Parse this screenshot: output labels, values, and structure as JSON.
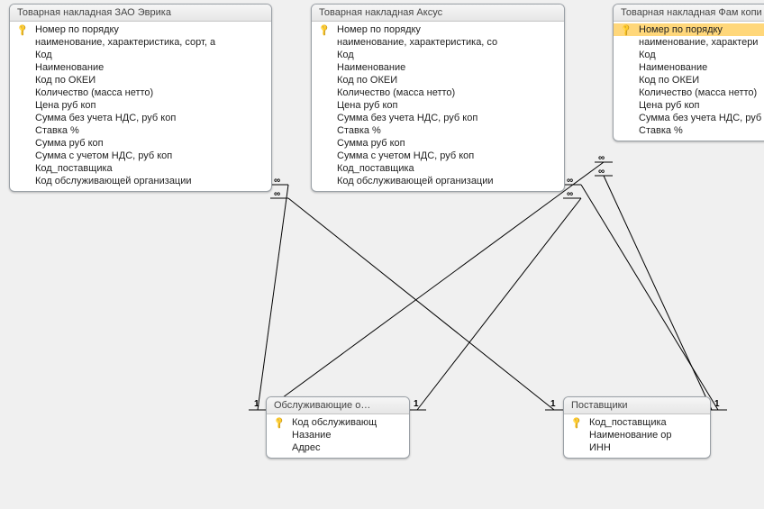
{
  "tables": {
    "evrika": {
      "title": "Товарная накладная ЗАО Эврика",
      "fields": [
        {
          "name": "Номер по порядку",
          "pk": true
        },
        {
          "name": "наименование, характеристика, сорт, а",
          "pk": false
        },
        {
          "name": "Код",
          "pk": false
        },
        {
          "name": "Наименование",
          "pk": false
        },
        {
          "name": "Код по ОКЕИ",
          "pk": false
        },
        {
          "name": "Количество (масса нетто)",
          "pk": false
        },
        {
          "name": "Цена руб коп",
          "pk": false
        },
        {
          "name": "Сумма без учета НДС, руб коп",
          "pk": false
        },
        {
          "name": "Ставка %",
          "pk": false
        },
        {
          "name": "Сумма руб коп",
          "pk": false
        },
        {
          "name": "Сумма с учетом НДС, руб коп",
          "pk": false
        },
        {
          "name": "Код_поставщика",
          "pk": false
        },
        {
          "name": "Код обслуживающей организации",
          "pk": false
        }
      ]
    },
    "aksus": {
      "title": "Товарная накладная Аксус",
      "fields": [
        {
          "name": "Номер по порядку",
          "pk": true
        },
        {
          "name": "наименование, характеристика, со",
          "pk": false
        },
        {
          "name": "Код",
          "pk": false
        },
        {
          "name": "Наименование",
          "pk": false
        },
        {
          "name": "Код по ОКЕИ",
          "pk": false
        },
        {
          "name": "Количество (масса нетто)",
          "pk": false
        },
        {
          "name": "Цена руб коп",
          "pk": false
        },
        {
          "name": "Сумма без учета НДС, руб коп",
          "pk": false
        },
        {
          "name": "Ставка %",
          "pk": false
        },
        {
          "name": "Сумма руб коп",
          "pk": false
        },
        {
          "name": "Сумма с учетом НДС, руб коп",
          "pk": false
        },
        {
          "name": "Код_поставщика",
          "pk": false
        },
        {
          "name": "Код обслуживающей организации",
          "pk": false
        }
      ]
    },
    "fam": {
      "title": "Товарная накладная Фам копи",
      "selected_index": 0,
      "fields": [
        {
          "name": "Номер по порядку",
          "pk": true
        },
        {
          "name": "наименование, характери",
          "pk": false
        },
        {
          "name": "Код",
          "pk": false
        },
        {
          "name": "Наименование",
          "pk": false
        },
        {
          "name": "Код по ОКЕИ",
          "pk": false
        },
        {
          "name": "Количество (масса нетто)",
          "pk": false
        },
        {
          "name": "Цена руб коп",
          "pk": false
        },
        {
          "name": "Сумма без учета НДС, руб",
          "pk": false
        },
        {
          "name": "Ставка %",
          "pk": false
        }
      ]
    },
    "serv": {
      "title": "Обслуживающие о…",
      "fields": [
        {
          "name": "Код обслуживающ",
          "pk": true
        },
        {
          "name": "Назание",
          "pk": false
        },
        {
          "name": "Адрес",
          "pk": false
        }
      ]
    },
    "supp": {
      "title": "Поставщики",
      "fields": [
        {
          "name": "Код_поставщика",
          "pk": true
        },
        {
          "name": "Наименование ор",
          "pk": false
        },
        {
          "name": "ИНН",
          "pk": false
        }
      ]
    }
  },
  "relations": [
    {
      "from": "evrika",
      "to": "serv",
      "many_side": "evrika"
    },
    {
      "from": "evrika",
      "to": "supp",
      "many_side": "evrika"
    },
    {
      "from": "aksus",
      "to": "serv",
      "many_side": "aksus"
    },
    {
      "from": "aksus",
      "to": "supp",
      "many_side": "aksus"
    },
    {
      "from": "fam",
      "to": "serv",
      "many_side": "fam"
    },
    {
      "from": "fam",
      "to": "supp",
      "many_side": "fam"
    }
  ],
  "glyph": {
    "infinity": "∞",
    "one": "1"
  }
}
